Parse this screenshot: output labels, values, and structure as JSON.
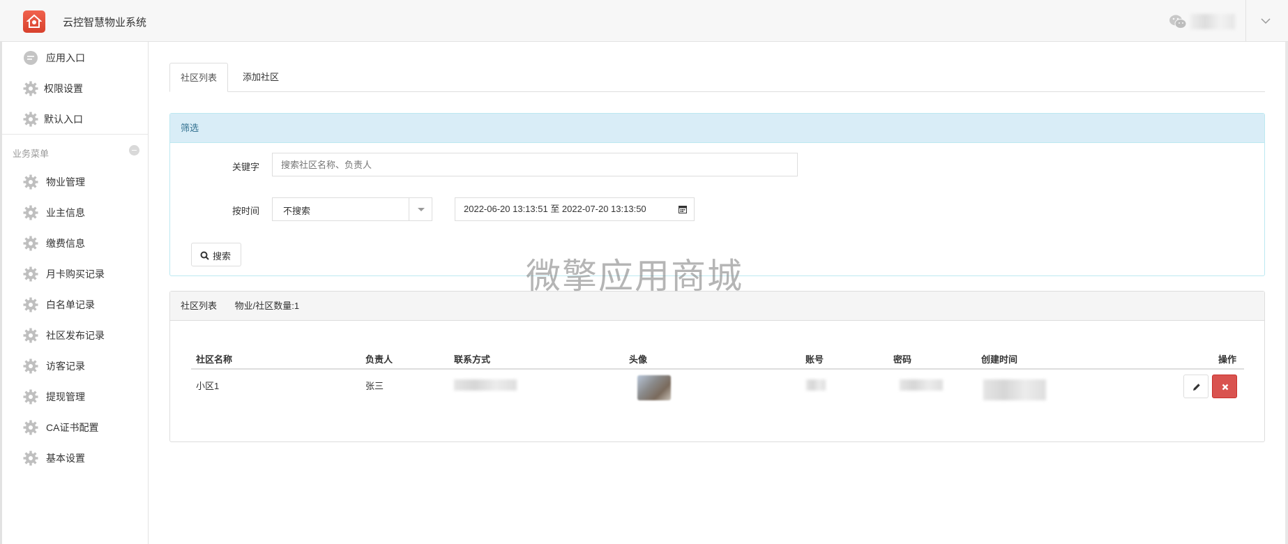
{
  "app": {
    "title": "云控智慧物业系统"
  },
  "sidebar": {
    "top_items": [
      {
        "label": "应用入口",
        "icon": "chat-bubble-icon"
      },
      {
        "label": "权限设置",
        "icon": "gear-icon"
      },
      {
        "label": "默认入口",
        "icon": "gear-icon"
      }
    ],
    "section_title": "业务菜单",
    "items": [
      {
        "label": "物业管理"
      },
      {
        "label": "业主信息"
      },
      {
        "label": "缴费信息"
      },
      {
        "label": "月卡购买记录"
      },
      {
        "label": "白名单记录"
      },
      {
        "label": "社区发布记录"
      },
      {
        "label": "访客记录"
      },
      {
        "label": "提现管理"
      },
      {
        "label": "CA证书配置"
      },
      {
        "label": "基本设置"
      }
    ]
  },
  "tabs": [
    {
      "label": "社区列表",
      "active": true
    },
    {
      "label": "添加社区",
      "active": false
    }
  ],
  "filter": {
    "title": "筛选",
    "keyword_label": "关键字",
    "keyword_placeholder": "搜索社区名称、负责人",
    "time_label": "按时间",
    "time_select_value": "不搜索",
    "date_range": "2022-06-20 13:13:51 至 2022-07-20 13:13:50",
    "search_button": "搜索"
  },
  "list": {
    "title": "社区列表",
    "count_text": "物业/社区数量:1",
    "columns": [
      "社区名称",
      "负责人",
      "联系方式",
      "头像",
      "账号",
      "密码",
      "创建时间",
      "操作"
    ],
    "rows": [
      {
        "name": "小区1",
        "manager": "张三"
      }
    ]
  },
  "watermark": "微擎应用商城",
  "colors": {
    "accent_info_bg": "#d9edf7",
    "accent_info_text": "#31708f",
    "danger": "#d9534f",
    "logo": "#e8503a"
  }
}
